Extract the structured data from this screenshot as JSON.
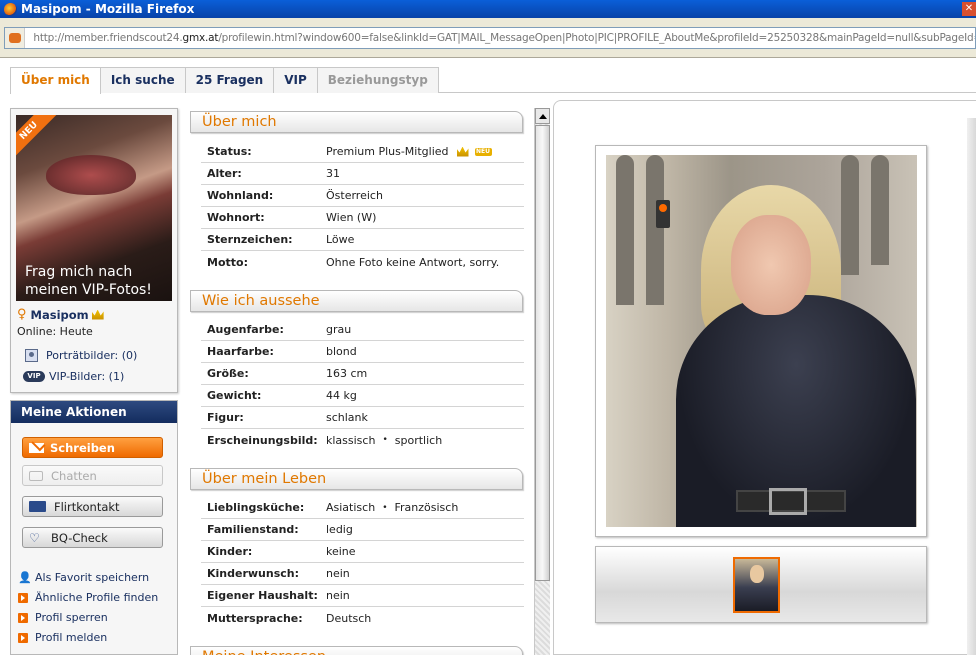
{
  "window": {
    "title": "Masipom - Mozilla Firefox"
  },
  "browser": {
    "url_prefix": "http://member.friendscout24.",
    "url_domain": "gmx.at",
    "url_rest": "/profilewin.html?window600=false&linkId=GAT|MAIL_MessageOpen|Photo|PIC|PROFILE_AboutMe&profileId=25250328&mainPageId=null&subPageId=null&ignoreCo"
  },
  "tabs": [
    {
      "label": "Über mich",
      "state": "active"
    },
    {
      "label": "Ich suche",
      "state": "normal"
    },
    {
      "label": "25 Fragen",
      "state": "normal"
    },
    {
      "label": "VIP",
      "state": "normal"
    },
    {
      "label": "Beziehungstyp",
      "state": "disabled"
    }
  ],
  "profile": {
    "promo_badge": "NEU",
    "promo_text_line1": "Frag mich nach",
    "promo_text_line2": "meinen VIP-Fotos!",
    "username": "Masipom",
    "online": "Online: Heute",
    "portrait_link": "Porträtbilder: (0)",
    "vip_badge": "VIP",
    "vip_link": "VIP-Bilder: (1)"
  },
  "actions": {
    "title": "Meine Aktionen",
    "write": "Schreiben",
    "chat": "Chatten",
    "flirt": "Flirtkontakt",
    "bq": "BQ-Check",
    "links": [
      "Als Favorit speichern",
      "Ähnliche Profile finden",
      "Profil sperren",
      "Profil melden"
    ]
  },
  "sections": {
    "about": {
      "title": "Über mich",
      "rows": [
        {
          "k": "Status:",
          "v": "Premium Plus-Mitglied"
        },
        {
          "k": "Alter:",
          "v": "31"
        },
        {
          "k": "Wohnland:",
          "v": "Österreich"
        },
        {
          "k": "Wohnort:",
          "v": "Wien (W)"
        },
        {
          "k": "Sternzeichen:",
          "v": "Löwe"
        },
        {
          "k": "Motto:",
          "v": "Ohne Foto keine Antwort, sorry."
        }
      ]
    },
    "looks": {
      "title": "Wie ich aussehe",
      "rows": [
        {
          "k": "Augenfarbe:",
          "v": "grau"
        },
        {
          "k": "Haarfarbe:",
          "v": "blond"
        },
        {
          "k": "Größe:",
          "v": "163 cm"
        },
        {
          "k": "Gewicht:",
          "v": "44 kg"
        },
        {
          "k": "Figur:",
          "v": "schlank"
        },
        {
          "k": "Erscheinungsbild:",
          "v": "klassisch",
          "v2": "sportlich"
        }
      ]
    },
    "life": {
      "title": "Über mein Leben",
      "rows": [
        {
          "k": "Lieblingsküche:",
          "v": "Asiatisch",
          "v2": "Französisch"
        },
        {
          "k": "Familienstand:",
          "v": "ledig"
        },
        {
          "k": "Kinder:",
          "v": "keine"
        },
        {
          "k": "Kinderwunsch:",
          "v": "nein"
        },
        {
          "k": "Eigener Haushalt:",
          "v": "nein"
        },
        {
          "k": "Muttersprache:",
          "v": "Deutsch"
        }
      ]
    },
    "interests": {
      "title": "Meine Interessen"
    }
  },
  "status_new_badge": "NEU",
  "separator": "•"
}
